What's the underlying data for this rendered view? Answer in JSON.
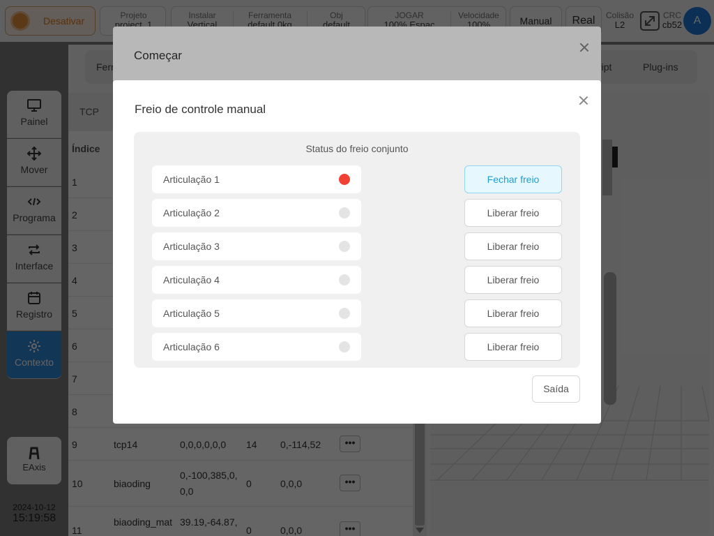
{
  "topbar": {
    "deactivate_label": "Desativar",
    "project": {
      "label": "Projeto",
      "value": "project_1"
    },
    "install": {
      "label": "Instalar",
      "value": "Vertical"
    },
    "tool": {
      "label": "Ferramenta",
      "value": "default    0kg"
    },
    "obj": {
      "label": "Obj",
      "value": "default"
    },
    "jog": {
      "label": "JOGAR",
      "value": "100%   Espac"
    },
    "speed": {
      "label": "Velocidade",
      "value": "100%"
    },
    "manual_label": "Manual",
    "real_label": "Real",
    "collision": {
      "label": "Colisão",
      "value": "L2"
    },
    "crc": {
      "label": "CRC",
      "value": "cb52"
    },
    "avatar_letter": "A"
  },
  "sidebar": {
    "items": [
      {
        "label": "Painel",
        "icon": "monitor-icon"
      },
      {
        "label": "Mover",
        "icon": "move-icon"
      },
      {
        "label": "Programa",
        "icon": "code-icon"
      },
      {
        "label": "Interface",
        "icon": "swap-icon"
      },
      {
        "label": "Registro",
        "icon": "calendar-icon"
      },
      {
        "label": "Contexto",
        "icon": "gear-icon"
      }
    ],
    "eaxis_label": "EAxis",
    "date": "2024-10-12",
    "time": "15:19:58"
  },
  "tabs": {
    "first": "Ferr",
    "script": "ript",
    "plugins": "Plug-ins"
  },
  "table": {
    "tcp_tab": "TCP",
    "index_header": "Índice",
    "rows": [
      {
        "idx": "1"
      },
      {
        "idx": "2"
      },
      {
        "idx": "3"
      },
      {
        "idx": "4"
      },
      {
        "idx": "5"
      },
      {
        "idx": "6"
      },
      {
        "idx": "7"
      },
      {
        "idx": "8"
      },
      {
        "idx": "9",
        "name": "tcp14",
        "coords": "0,0,0,0,0,0",
        "num": "14",
        "extra": "0,-114,52"
      },
      {
        "idx": "10",
        "name": "biaoding",
        "coords": "0,-100,385,0,",
        "coords2": "0,0",
        "num": "0",
        "extra": "0,0,0"
      },
      {
        "idx": "11",
        "name": "biaoding_mat",
        "coords": "39.19,-64.87,",
        "num": "0",
        "extra": "0,0,0"
      }
    ],
    "more_label": "•••"
  },
  "dialog_start": {
    "title": "Começar"
  },
  "dialog_brake": {
    "title": "Freio de controle manual",
    "panel_title": "Status do freio conjunto",
    "joints": [
      {
        "name": "Articulação 1",
        "action": "Fechar freio",
        "released": true
      },
      {
        "name": "Articulação 2",
        "action": "Liberar freio",
        "released": false
      },
      {
        "name": "Articulação 3",
        "action": "Liberar freio",
        "released": false
      },
      {
        "name": "Articulação 4",
        "action": "Liberar freio",
        "released": false
      },
      {
        "name": "Articulação 5",
        "action": "Liberar freio",
        "released": false
      },
      {
        "name": "Articulação 6",
        "action": "Liberar freio",
        "released": false
      }
    ],
    "exit_label": "Saída"
  },
  "colors": {
    "accent": "#2f8ad8",
    "warning": "#e8903c",
    "brake_on": "#f04134",
    "close_brake_text": "#1e9fd0"
  }
}
